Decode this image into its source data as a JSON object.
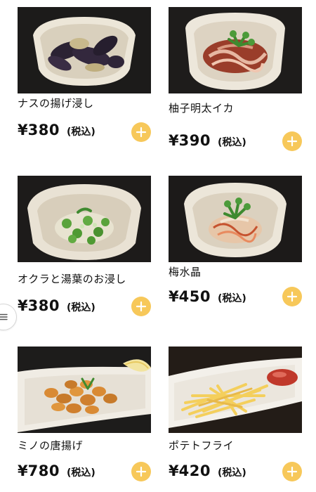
{
  "menu": {
    "items": [
      {
        "name": "ナスの揚げ浸し",
        "yen": "¥",
        "price": "380",
        "tax": "(税込)",
        "photo_icon": "eggplant-dish-photo"
      },
      {
        "name": "柚子明太イカ",
        "yen": "¥",
        "price": "390",
        "tax": "(税込)",
        "photo_icon": "squid-dish-photo"
      },
      {
        "name": "オクラと湯葉のお浸し",
        "yen": "¥",
        "price": "380",
        "tax": "(税込)",
        "photo_icon": "okra-dish-photo"
      },
      {
        "name": "梅水晶",
        "yen": "¥",
        "price": "450",
        "tax": "(税込)",
        "photo_icon": "ume-suisho-dish-photo"
      },
      {
        "name": "ミノの唐揚げ",
        "yen": "¥",
        "price": "780",
        "tax": "(税込)",
        "photo_icon": "fried-tripe-dish-photo"
      },
      {
        "name": "ポテトフライ",
        "yen": "¥",
        "price": "420",
        "tax": "(税込)",
        "photo_icon": "french-fries-dish-photo"
      }
    ]
  },
  "controls": {
    "add_icon": "plus-icon",
    "side_menu_icon": "hamburger-menu-icon"
  },
  "colors": {
    "accent": "#f7c85a",
    "text": "#111111",
    "photo_background": "#1a1a1a"
  }
}
